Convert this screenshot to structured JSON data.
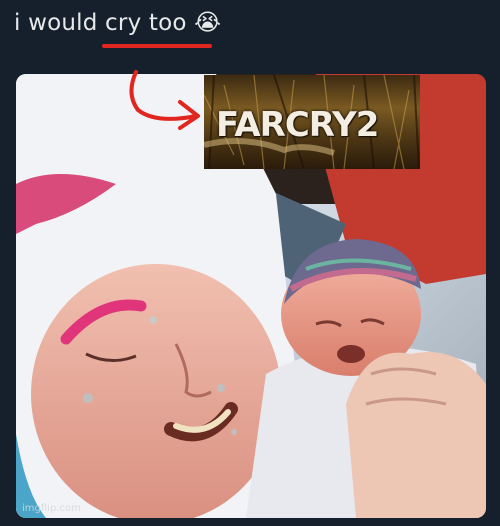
{
  "caption": {
    "text": "i would cry too 😭",
    "underline_color": "#e0261f"
  },
  "logo": {
    "text": "FARCRY2"
  },
  "arrow": {
    "color": "#e0261f"
  },
  "watermark": "imgflip.com"
}
